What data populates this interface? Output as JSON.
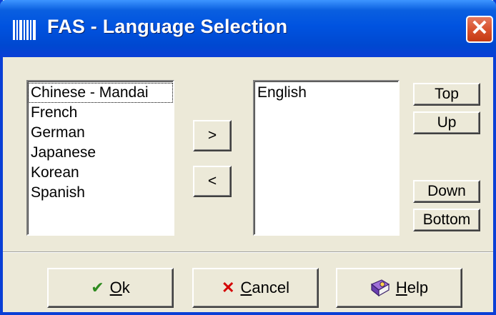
{
  "window": {
    "title": "FAS - Language Selection",
    "close_label": "✕"
  },
  "available_languages": [
    "Chinese - Mandai",
    "French",
    "German",
    "Japanese",
    "Korean",
    "Spanish"
  ],
  "selected_languages": [
    "English"
  ],
  "transfer": {
    "add_label": ">",
    "remove_label": "<"
  },
  "order": {
    "top": "Top",
    "up": "Up",
    "down": "Down",
    "bottom": "Bottom"
  },
  "footer": {
    "ok_mnemonic": "O",
    "ok_rest": "k",
    "cancel_mnemonic": "C",
    "cancel_rest": "ancel",
    "help_mnemonic": "H",
    "help_rest": "elp"
  },
  "icons": {
    "ok": "checkmark-icon",
    "cancel": "x-icon",
    "help": "help-book-icon",
    "app": "barcode-icon"
  },
  "colors": {
    "titlebar": "#0053e0",
    "face": "#ece9d8",
    "close": "#d9532e"
  }
}
